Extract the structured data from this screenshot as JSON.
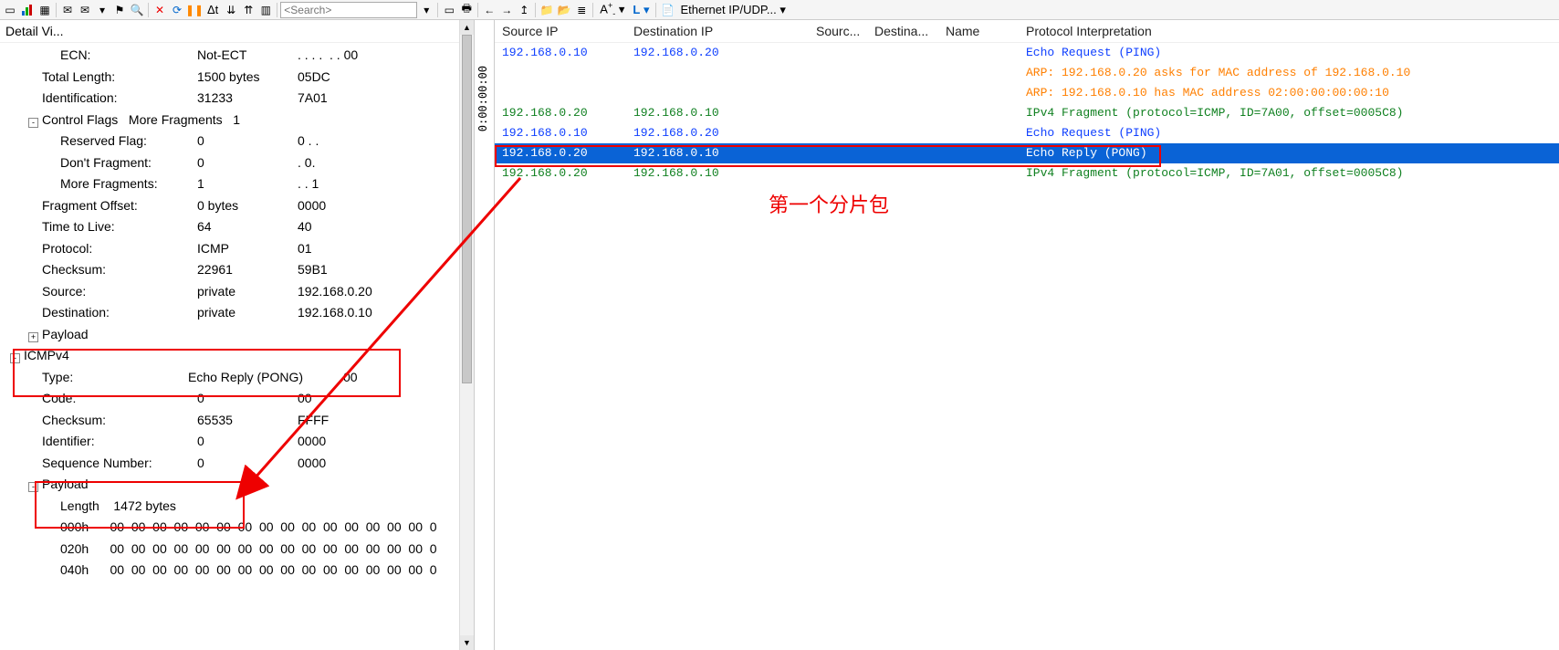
{
  "toolbar": {
    "search_placeholder": "<Search>",
    "delta_label": "Δt",
    "font_label": "A",
    "layout_label": "L",
    "profile_label": "Ethernet IP/UDP..."
  },
  "left": {
    "title": "Detail Vi...",
    "rows": [
      {
        "lvl": 3,
        "exp": "",
        "c0": "ECN:",
        "c1": "Not-ECT",
        "c2": ". . . .  . . 00"
      },
      {
        "lvl": 2,
        "exp": "",
        "c0": "Total Length:",
        "c1": "1500 bytes",
        "c2": "05DC"
      },
      {
        "lvl": 2,
        "exp": "",
        "c0": "Identification:",
        "c1": "31233",
        "c2": "7A01"
      },
      {
        "lvl": 2,
        "exp": "-",
        "c0": "Control Flags   More Fragments   1",
        "c1": "",
        "c2": "",
        "full": true
      },
      {
        "lvl": 3,
        "exp": "",
        "c0": "Reserved Flag:",
        "c1": "0",
        "c2": "0 . ."
      },
      {
        "lvl": 3,
        "exp": "",
        "c0": "Don't Fragment:",
        "c1": "0",
        "c2": ". 0."
      },
      {
        "lvl": 3,
        "exp": "",
        "c0": "More Fragments:",
        "c1": "1",
        "c2": ". . 1"
      },
      {
        "lvl": 2,
        "exp": "",
        "c0": "Fragment Offset:",
        "c1": "0 bytes",
        "c2": "0000"
      },
      {
        "lvl": 2,
        "exp": "",
        "c0": "Time to Live:",
        "c1": "64",
        "c2": "40"
      },
      {
        "lvl": 2,
        "exp": "",
        "c0": "Protocol:",
        "c1": "ICMP",
        "c2": "01"
      },
      {
        "lvl": 2,
        "exp": "",
        "c0": "Checksum:",
        "c1": "22961",
        "c2": "59B1"
      },
      {
        "lvl": 2,
        "exp": "",
        "c0": "Source:",
        "c1": "private",
        "c2": "192.168.0.20"
      },
      {
        "lvl": 2,
        "exp": "",
        "c0": "Destination:",
        "c1": "private",
        "c2": "192.168.0.10"
      },
      {
        "lvl": 2,
        "exp": "+",
        "c0": "Payload",
        "c1": "",
        "c2": ""
      },
      {
        "lvl": 1,
        "exp": "-",
        "c0": "ICMPv4",
        "c1": "",
        "c2": ""
      },
      {
        "lvl": 2,
        "exp": "",
        "c0": "Type:",
        "c1": "Echo Reply (PONG)",
        "c2": "00",
        "wide": true
      },
      {
        "lvl": 2,
        "exp": "",
        "c0": "Code:",
        "c1": "0",
        "c2": "00"
      },
      {
        "lvl": 2,
        "exp": "",
        "c0": "Checksum:",
        "c1": "65535",
        "c2": "FFFF"
      },
      {
        "lvl": 2,
        "exp": "",
        "c0": "Identifier:",
        "c1": "0",
        "c2": "0000"
      },
      {
        "lvl": 2,
        "exp": "",
        "c0": "Sequence Number:",
        "c1": "0",
        "c2": "0000"
      },
      {
        "lvl": 2,
        "exp": "-",
        "c0": "Payload",
        "c1": "",
        "c2": ""
      },
      {
        "lvl": 3,
        "exp": "",
        "c0": "Length    1472 bytes",
        "c1": "",
        "c2": "",
        "full": true
      },
      {
        "lvl": 3,
        "exp": "",
        "c0": "000h      00  00  00  00  00  00  00  00  00  00  00  00  00  00  00  0",
        "c1": "",
        "c2": "",
        "full": true
      },
      {
        "lvl": 3,
        "exp": "",
        "c0": "020h      00  00  00  00  00  00  00  00  00  00  00  00  00  00  00  0",
        "c1": "",
        "c2": "",
        "full": true
      },
      {
        "lvl": 3,
        "exp": "",
        "c0": "040h      00  00  00  00  00  00  00  00  00  00  00  00  00  00  00  0",
        "c1": "",
        "c2": "",
        "full": true
      }
    ]
  },
  "mid": {
    "time": "0:00:00:00"
  },
  "packets": {
    "headers": {
      "src": "Source IP",
      "dst": "Destination IP",
      "sp": "Sourc...",
      "dp": "Destina...",
      "nm": "Name",
      "pi": "Protocol Interpretation"
    },
    "rows": [
      {
        "src": "192.168.0.10",
        "dst": "192.168.0.20",
        "pi": "Echo Request (PING)",
        "cls": "clr-blue"
      },
      {
        "src": "",
        "dst": "",
        "pi": "ARP: 192.168.0.20 asks for MAC address of 192.168.0.10",
        "cls": "clr-orange"
      },
      {
        "src": "",
        "dst": "",
        "pi": "ARP: 192.168.0.10 has MAC address 02:00:00:00:00:10",
        "cls": "clr-orange"
      },
      {
        "src": "192.168.0.20",
        "dst": "192.168.0.10",
        "pi": "IPv4 Fragment (protocol=ICMP, ID=7A00, offset=0005C8)",
        "cls": "clr-green"
      },
      {
        "src": "192.168.0.10",
        "dst": "192.168.0.20",
        "pi": "Echo Request (PING)",
        "cls": "clr-blue"
      },
      {
        "src": "192.168.0.20",
        "dst": "192.168.0.10",
        "pi": "Echo Reply (PONG)",
        "cls": "",
        "sel": true
      },
      {
        "src": "192.168.0.20",
        "dst": "192.168.0.10",
        "pi": "IPv4 Fragment (protocol=ICMP, ID=7A01, offset=0005C8)",
        "cls": "clr-green"
      }
    ]
  },
  "annotation": {
    "text": "第一个分片包"
  }
}
